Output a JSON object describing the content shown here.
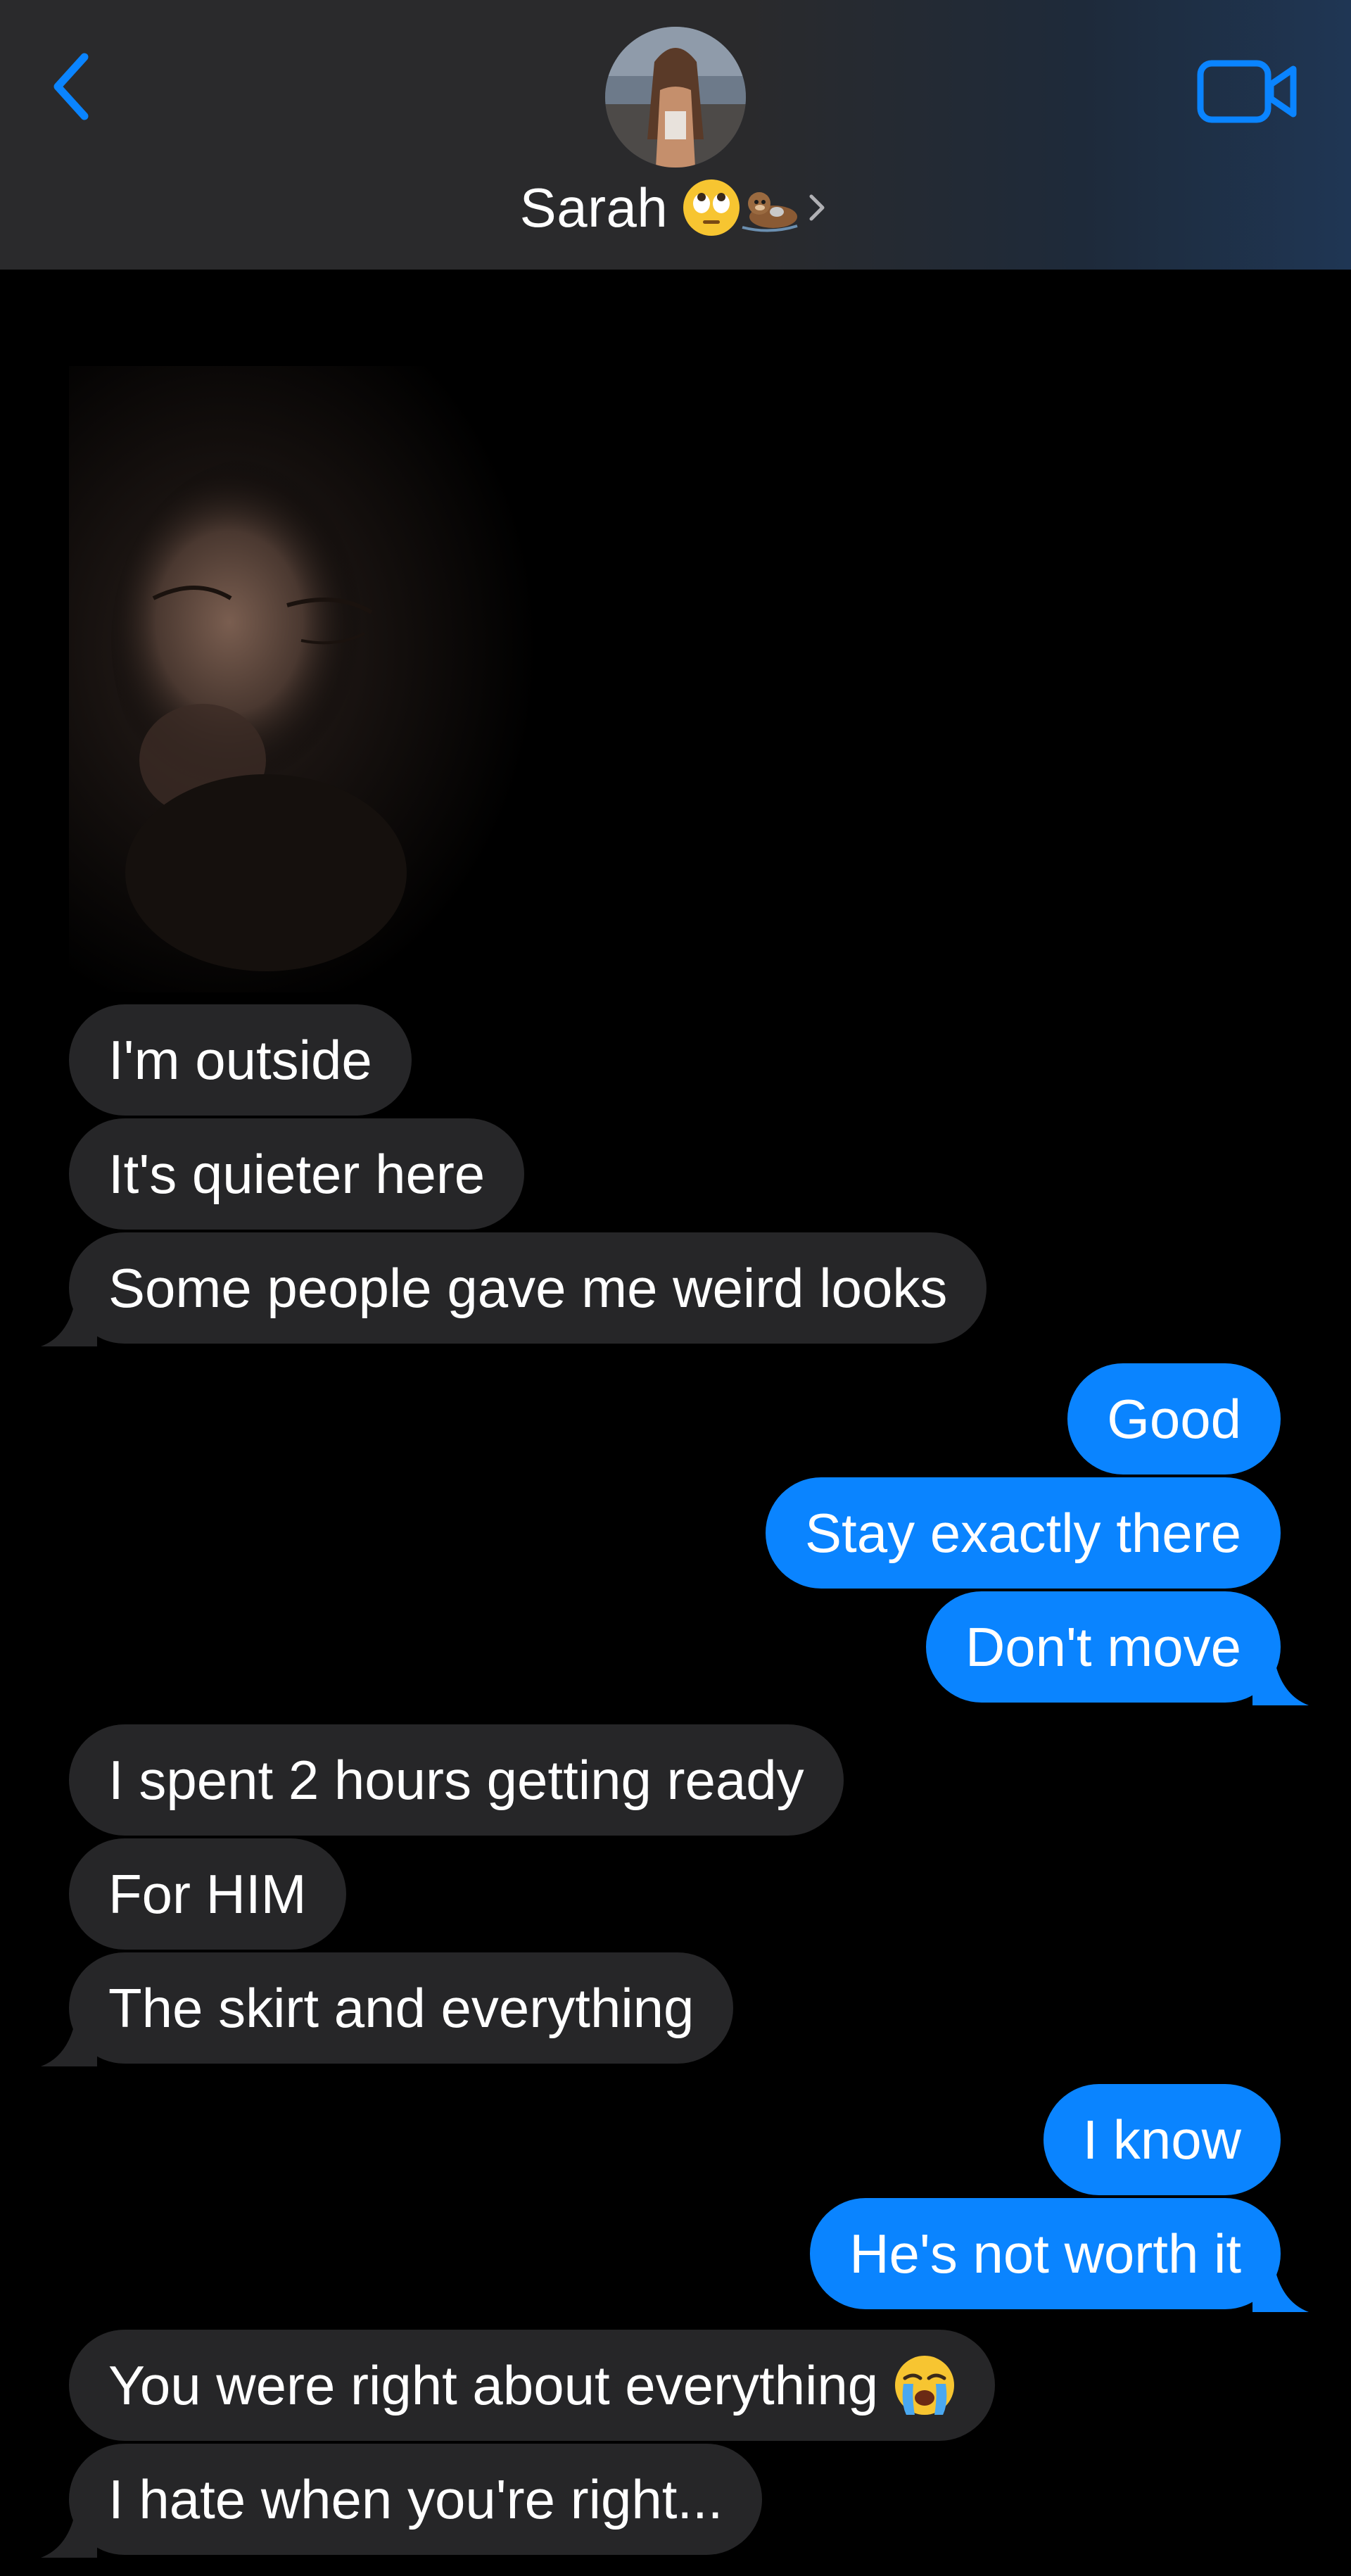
{
  "header": {
    "contact_name": "Sarah",
    "name_emojis": [
      "face-with-rolling-eyes-icon",
      "otter-icon"
    ],
    "icons": {
      "back": "chevron-left-icon",
      "video": "video-camera-icon",
      "disclosure": "chevron-right-icon"
    },
    "accent_color": "#0a84ff"
  },
  "conversation": {
    "photo": {
      "kind": "received-photo"
    },
    "messages": [
      {
        "from": "them",
        "text": "I'm outside"
      },
      {
        "from": "them",
        "text": "It's quieter here"
      },
      {
        "from": "them",
        "text": "Some people gave me weird looks"
      },
      {
        "from": "me",
        "text": "Good"
      },
      {
        "from": "me",
        "text": "Stay exactly there"
      },
      {
        "from": "me",
        "text": "Don't move"
      },
      {
        "from": "them",
        "text": "I spent 2 hours getting ready"
      },
      {
        "from": "them",
        "text": "For HIM"
      },
      {
        "from": "them",
        "text": "The skirt and everything"
      },
      {
        "from": "me",
        "text": "I know"
      },
      {
        "from": "me",
        "text": "He's not worth it"
      },
      {
        "from": "them",
        "text": "You were right about everything",
        "emoji": "loudly-crying-face-icon"
      },
      {
        "from": "them",
        "text": "I hate when you're right..."
      }
    ],
    "colors": {
      "received_bubble": "#262628",
      "sent_bubble": "#0a84ff",
      "text": "#ffffff"
    }
  }
}
